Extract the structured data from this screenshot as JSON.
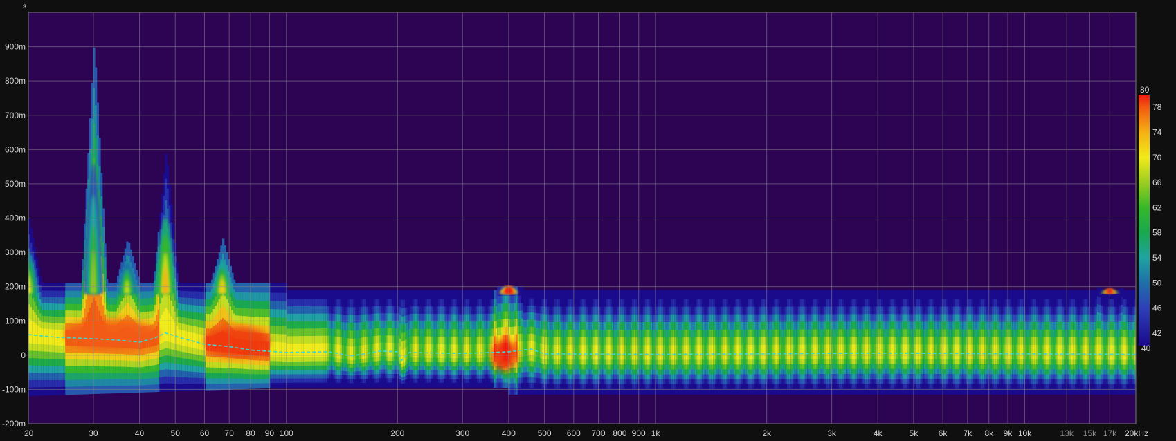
{
  "chart_data": {
    "type": "heatmap",
    "title": "",
    "ylabel": "s",
    "xscale": "log",
    "xlim": [
      20,
      20000
    ],
    "ylim": [
      -0.2,
      1.0
    ],
    "grid": true,
    "x_ticks": [
      {
        "label": "20",
        "value": 20
      },
      {
        "label": "30",
        "value": 30
      },
      {
        "label": "40",
        "value": 40
      },
      {
        "label": "50",
        "value": 50
      },
      {
        "label": "60",
        "value": 60
      },
      {
        "label": "70",
        "value": 70
      },
      {
        "label": "80",
        "value": 80
      },
      {
        "label": "90",
        "value": 90
      },
      {
        "label": "100",
        "value": 100
      },
      {
        "label": "200",
        "value": 200
      },
      {
        "label": "300",
        "value": 300
      },
      {
        "label": "400",
        "value": 400
      },
      {
        "label": "500",
        "value": 500
      },
      {
        "label": "600",
        "value": 600
      },
      {
        "label": "700",
        "value": 700
      },
      {
        "label": "800",
        "value": 800
      },
      {
        "label": "900",
        "value": 900
      },
      {
        "label": "1k",
        "value": 1000
      },
      {
        "label": "2k",
        "value": 2000
      },
      {
        "label": "3k",
        "value": 3000
      },
      {
        "label": "4k",
        "value": 4000
      },
      {
        "label": "5k",
        "value": 5000
      },
      {
        "label": "6k",
        "value": 6000
      },
      {
        "label": "7k",
        "value": 7000
      },
      {
        "label": "8k",
        "value": 8000
      },
      {
        "label": "9k",
        "value": 9000
      },
      {
        "label": "10k",
        "value": 10000
      },
      {
        "label": "13k",
        "value": 13000,
        "dim": true
      },
      {
        "label": "15k",
        "value": 15000,
        "dim": true
      },
      {
        "label": "17k",
        "value": 17000,
        "dim": true
      },
      {
        "label": "20kHz",
        "value": 20000
      }
    ],
    "y_ticks": [
      {
        "label": "900m",
        "value": 0.9
      },
      {
        "label": "800m",
        "value": 0.8
      },
      {
        "label": "700m",
        "value": 0.7
      },
      {
        "label": "600m",
        "value": 0.6
      },
      {
        "label": "500m",
        "value": 0.5
      },
      {
        "label": "400m",
        "value": 0.4
      },
      {
        "label": "300m",
        "value": 0.3
      },
      {
        "label": "200m",
        "value": 0.2
      },
      {
        "label": "100m",
        "value": 0.1
      },
      {
        "label": "0",
        "value": 0
      },
      {
        "label": "-100m",
        "value": -0.1
      },
      {
        "label": "-200m",
        "value": -0.2
      }
    ],
    "colorbar": {
      "min": 40,
      "max": 80,
      "ticks": [
        {
          "label": "80",
          "value": 80
        },
        {
          "label": "78",
          "value": 78
        },
        {
          "label": "74",
          "value": 74
        },
        {
          "label": "70",
          "value": 70
        },
        {
          "label": "66",
          "value": 66
        },
        {
          "label": "62",
          "value": 62
        },
        {
          "label": "58",
          "value": 58
        },
        {
          "label": "54",
          "value": 54
        },
        {
          "label": "50",
          "value": 50
        },
        {
          "label": "46",
          "value": 46
        },
        {
          "label": "42",
          "value": 42
        },
        {
          "label": "40",
          "value": 40
        }
      ],
      "stops": [
        {
          "level": 40,
          "color": "#1a0a8c"
        },
        {
          "level": 46,
          "color": "#2e40b8"
        },
        {
          "level": 50,
          "color": "#1f6fa8"
        },
        {
          "level": 54,
          "color": "#1fa3a0"
        },
        {
          "level": 58,
          "color": "#19a84e"
        },
        {
          "level": 62,
          "color": "#36b82a"
        },
        {
          "level": 66,
          "color": "#9ccd22"
        },
        {
          "level": 70,
          "color": "#f2ea1a"
        },
        {
          "level": 74,
          "color": "#f5b014"
        },
        {
          "level": 78,
          "color": "#f25a12"
        },
        {
          "level": 80,
          "color": "#ee1a10"
        }
      ]
    },
    "background_color": "#2d0454",
    "trace_color": "#3ed6d0",
    "center_line": [
      {
        "f": 20,
        "t": 0.06
      },
      {
        "f": 24,
        "t": 0.052
      },
      {
        "f": 30,
        "t": 0.048
      },
      {
        "f": 35,
        "t": 0.044
      },
      {
        "f": 40,
        "t": 0.038
      },
      {
        "f": 44,
        "t": 0.05
      },
      {
        "f": 47,
        "t": 0.065
      },
      {
        "f": 52,
        "t": 0.05
      },
      {
        "f": 60,
        "t": 0.032
      },
      {
        "f": 70,
        "t": 0.025
      },
      {
        "f": 80,
        "t": 0.015
      },
      {
        "f": 100,
        "t": 0.008
      },
      {
        "f": 130,
        "t": 0.01
      },
      {
        "f": 150,
        "t": -0.002
      },
      {
        "f": 180,
        "t": 0.012
      },
      {
        "f": 200,
        "t": 0.01
      },
      {
        "f": 205,
        "t": -0.015
      },
      {
        "f": 215,
        "t": 0.008
      },
      {
        "f": 300,
        "t": 0.005
      },
      {
        "f": 400,
        "t": 0.01
      },
      {
        "f": 460,
        "t": 0.018
      },
      {
        "f": 500,
        "t": 0.004
      },
      {
        "f": 1000,
        "t": 0.003
      },
      {
        "f": 2000,
        "t": 0.004
      },
      {
        "f": 4000,
        "t": 0.006
      },
      {
        "f": 10000,
        "t": 0.004
      },
      {
        "f": 20000,
        "t": 0.003
      }
    ],
    "spectral_peaks": [
      {
        "f": 20,
        "top": 0.4,
        "max_level": 62
      },
      {
        "f": 30,
        "top": 0.92,
        "max_level": 58
      },
      {
        "f": 37,
        "top": 0.34,
        "max_level": 60
      },
      {
        "f": 47,
        "top": 0.6,
        "max_level": 66
      },
      {
        "f": 67,
        "top": 0.34,
        "max_level": 64
      },
      {
        "f": 400,
        "top": 0.2,
        "max_level": 80
      },
      {
        "f": 17000,
        "top": 0.18,
        "max_level": 76
      }
    ],
    "hot_regions": [
      {
        "f_from": 25,
        "f_to": 45,
        "t_center": 0.06,
        "level": 78
      },
      {
        "f_from": 60,
        "f_to": 90,
        "t_center": 0.04,
        "level": 79
      },
      {
        "f_from": 360,
        "f_to": 420,
        "t_center": 0.0,
        "level": 80
      }
    ]
  }
}
